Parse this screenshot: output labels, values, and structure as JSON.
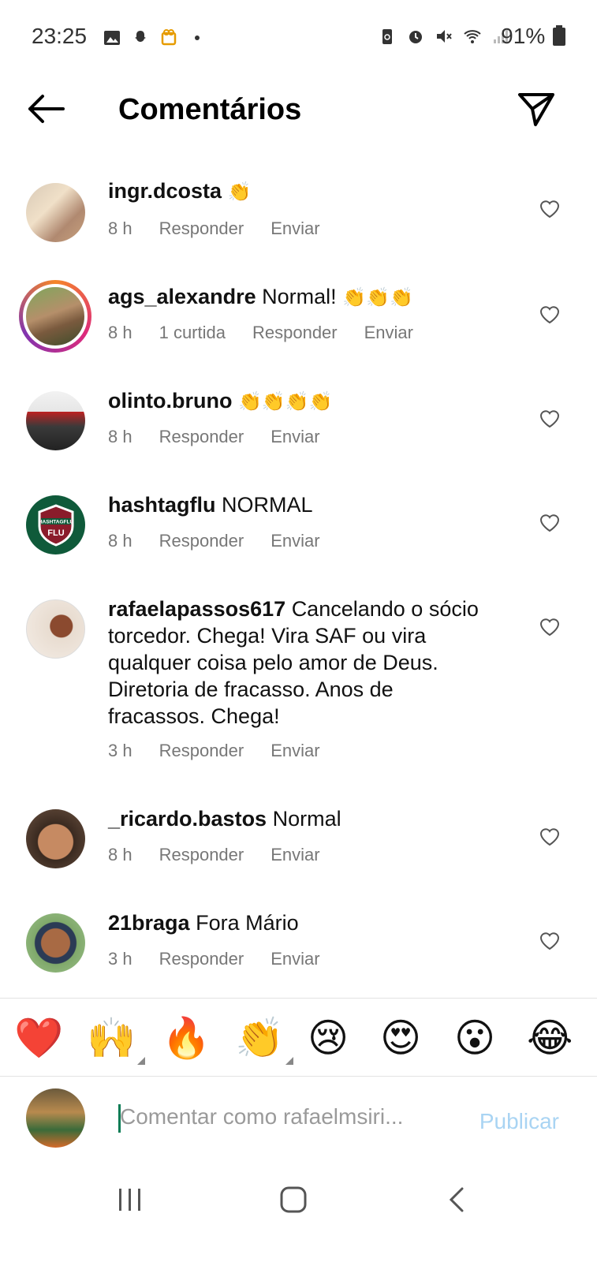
{
  "status_bar": {
    "time": "23:25",
    "battery": "91%"
  },
  "header": {
    "title": "Comentários"
  },
  "comments": [
    {
      "username": "ingr.dcosta",
      "text": "",
      "claps": "👏",
      "time": "8 h",
      "likes": "",
      "reply": "Responder",
      "send": "Enviar"
    },
    {
      "username": "ags_alexandre",
      "text": "Normal!",
      "claps": "👏👏👏",
      "time": "8 h",
      "likes": "1 curtida",
      "reply": "Responder",
      "send": "Enviar"
    },
    {
      "username": "olinto.bruno",
      "text": "",
      "claps": "👏👏👏👏",
      "time": "8 h",
      "likes": "",
      "reply": "Responder",
      "send": "Enviar"
    },
    {
      "username": "hashtagflu",
      "text": "NORMAL",
      "claps": "",
      "time": "8 h",
      "likes": "",
      "reply": "Responder",
      "send": "Enviar"
    },
    {
      "username": "rafaelapassos617",
      "text": "Cancelando o sócio torcedor. Chega! Vira SAF ou vira qualquer coisa pelo amor de Deus. Diretoria de fracasso. Anos de fracassos. Chega!",
      "claps": "",
      "time": "3 h",
      "likes": "",
      "reply": "Responder",
      "send": "Enviar"
    },
    {
      "username": "_ricardo.bastos",
      "text": "Normal",
      "claps": "",
      "time": "8 h",
      "likes": "",
      "reply": "Responder",
      "send": "Enviar"
    },
    {
      "username": "21braga",
      "text": "Fora Mário",
      "claps": "",
      "time": "3 h",
      "likes": "",
      "reply": "Responder",
      "send": "Enviar"
    }
  ],
  "avatar_badge": {
    "line1": "HASHTAGFLU",
    "line2": "FLU"
  },
  "emoji_bar": [
    "❤️",
    "🙌",
    "🔥",
    "👏",
    "😢",
    "😍",
    "😮",
    "😂"
  ],
  "input": {
    "placeholder": "Comentar como rafaelmsiri...",
    "publish_label": "Publicar"
  },
  "colors": {
    "publish": "#a9d4f3",
    "caret": "#0a7c55",
    "meta": "#777777"
  }
}
